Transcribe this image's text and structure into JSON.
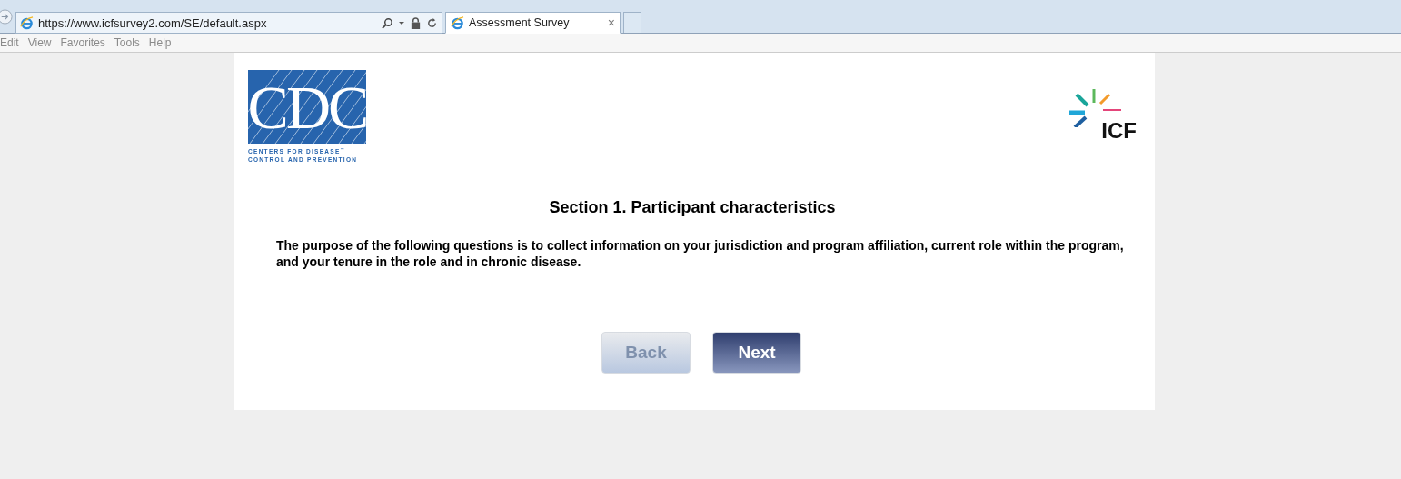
{
  "browser": {
    "address": "https://www.icfsurvey2.com/SE/default.aspx",
    "tabs": [
      {
        "label": "Assessment Survey",
        "close": "×",
        "selected": true
      }
    ],
    "menu": [
      "Edit",
      "View",
      "Favorites",
      "Tools",
      "Help"
    ]
  },
  "logos": {
    "cdc": {
      "mark": "CDC",
      "line_1": "CENTERS FOR DISEASE",
      "trademark": "™",
      "line_2": "CONTROL AND PREVENTION"
    },
    "icf": {
      "mark": "ICF"
    }
  },
  "section": {
    "title": "Section 1. Participant characteristics",
    "intro": "The purpose of the following questions is to collect information on your jurisdiction and program affiliation, current role within the program, and your tenure in the role and in chronic disease."
  },
  "buttons": [
    {
      "label": "Back",
      "disabled": true
    },
    {
      "label": "Next",
      "disabled": false
    }
  ]
}
